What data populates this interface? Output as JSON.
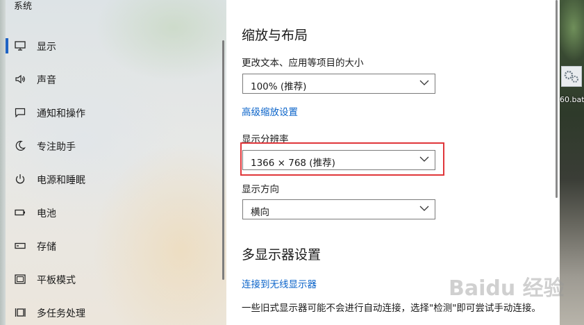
{
  "nav": {
    "heading": "系统",
    "items": [
      {
        "label": "显示",
        "icon": "monitor-icon",
        "active": true
      },
      {
        "label": "声音",
        "icon": "speaker-icon"
      },
      {
        "label": "通知和操作",
        "icon": "message-icon"
      },
      {
        "label": "专注助手",
        "icon": "moon-icon"
      },
      {
        "label": "电源和睡眠",
        "icon": "power-icon"
      },
      {
        "label": "电池",
        "icon": "battery-icon"
      },
      {
        "label": "存储",
        "icon": "storage-icon"
      },
      {
        "label": "平板模式",
        "icon": "tablet-icon"
      },
      {
        "label": "多任务处理",
        "icon": "multitask-icon"
      }
    ]
  },
  "main": {
    "scale_section_title": "缩放与布局",
    "scale_label": "更改文本、应用等项目的大小",
    "scale_value": "100% (推荐)",
    "advanced_scaling_link": "高级缩放设置",
    "resolution_label": "显示分辨率",
    "resolution_value": "1366 × 768 (推荐)",
    "orientation_label": "显示方向",
    "orientation_value": "横向",
    "multi_display_title": "多显示器设置",
    "wireless_link": "连接到无线显示器",
    "description": "一些旧式显示器可能不会进行自动连接，选择\"检测\"即可尝试手动连接。"
  },
  "desktop": {
    "file_label": "60.bat"
  },
  "watermark": "Baidu 经验",
  "colors": {
    "accent": "#1f63c4",
    "link": "#0a63c9",
    "highlight_box": "#e0363a"
  }
}
